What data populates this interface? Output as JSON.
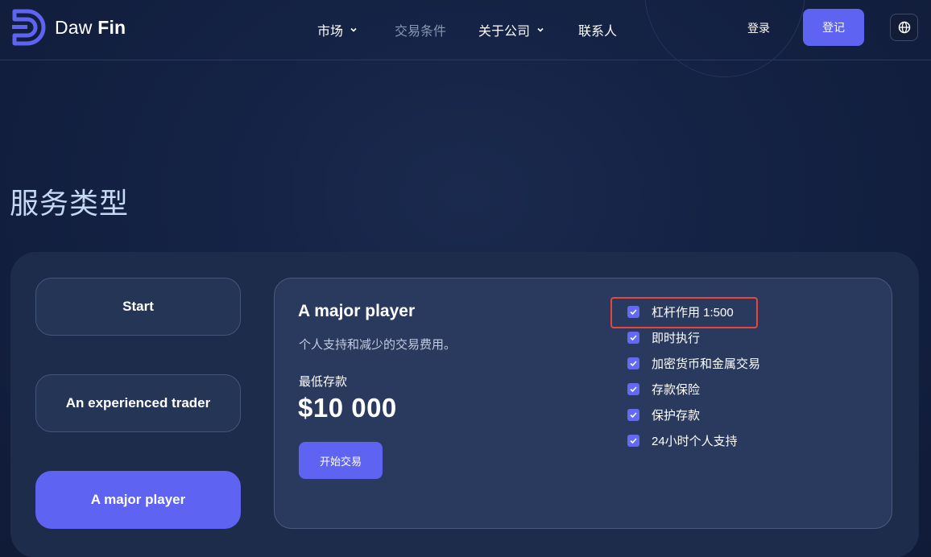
{
  "brand": {
    "name_regular": "Daw",
    "name_bold": "Fin",
    "accent_color": "#5f63f2"
  },
  "nav": {
    "items": [
      {
        "label": "市场",
        "has_dropdown": true
      },
      {
        "label": "交易条件",
        "has_dropdown": false,
        "muted": true
      },
      {
        "label": "关于公司",
        "has_dropdown": true
      },
      {
        "label": "联系人",
        "has_dropdown": false
      }
    ],
    "login_label": "登录",
    "signup_label": "登记",
    "language_icon": "globe-icon"
  },
  "page_title": "服务类型",
  "account_tabs": [
    {
      "label": "Start",
      "active": false
    },
    {
      "label": "An experienced trader",
      "active": false
    },
    {
      "label": "A major player",
      "active": true
    }
  ],
  "card": {
    "title": "A major player",
    "description": "个人支持和减少的交易费用。",
    "deposit_label": "最低存款",
    "deposit_amount": "$10 000",
    "cta_label": "开始交易",
    "features": [
      {
        "label": "杠杆作用 1:500",
        "checked": true,
        "highlighted": true
      },
      {
        "label": "即时执行",
        "checked": true
      },
      {
        "label": "加密货币和金属交易",
        "checked": true
      },
      {
        "label": "存款保险",
        "checked": true
      },
      {
        "label": "保护存款",
        "checked": true
      },
      {
        "label": "24小时个人支持",
        "checked": true
      }
    ]
  },
  "colors": {
    "highlight": "#e8453c",
    "background": "#142244"
  }
}
